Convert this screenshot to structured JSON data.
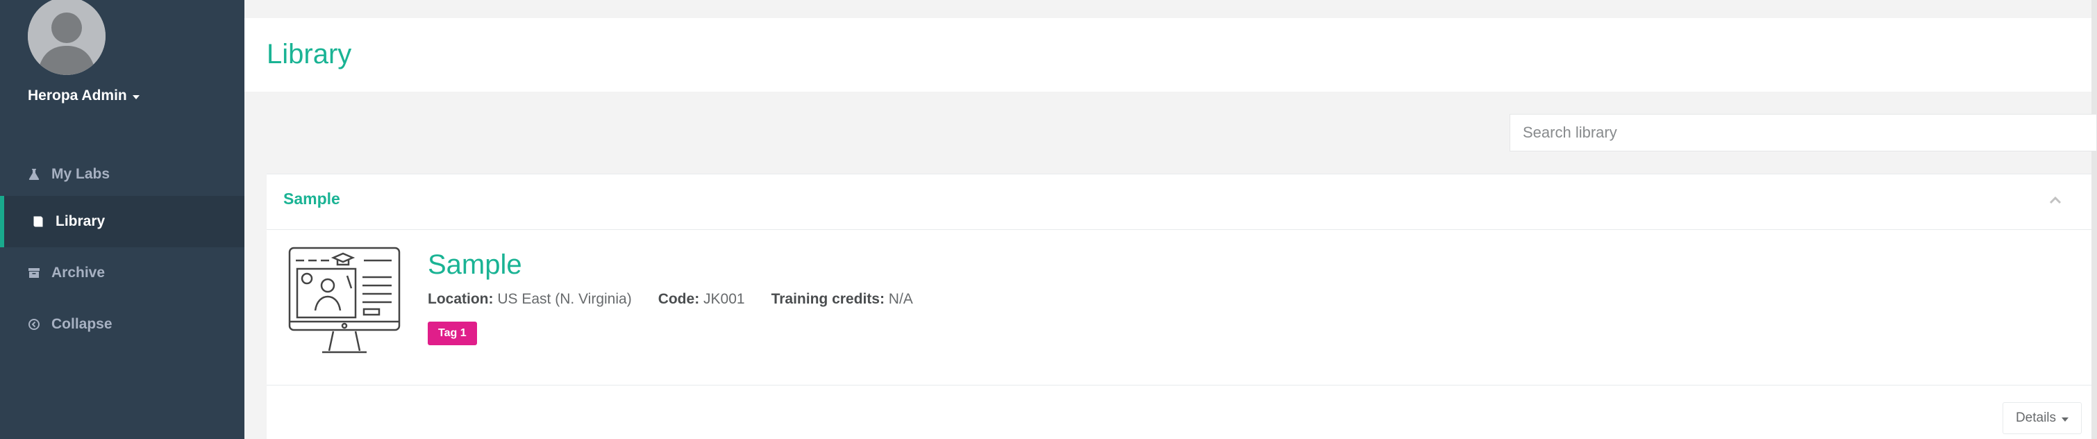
{
  "user": {
    "name": "Heropa Admin"
  },
  "sidebar": {
    "items": [
      {
        "label": "My Labs",
        "icon": "flask-icon",
        "active": false
      },
      {
        "label": "Library",
        "icon": "book-icon",
        "active": true
      },
      {
        "label": "Archive",
        "icon": "archive-icon",
        "active": false
      },
      {
        "label": "Collapse",
        "icon": "collapse-circle-icon",
        "active": false
      }
    ]
  },
  "page": {
    "title": "Library"
  },
  "search": {
    "placeholder": "Search library",
    "value": ""
  },
  "panel": {
    "title": "Sample",
    "item": {
      "title": "Sample",
      "location_label": "Location:",
      "location_value": "US East (N. Virginia)",
      "code_label": "Code:",
      "code_value": "JK001",
      "credits_label": "Training credits:",
      "credits_value": "N/A",
      "tag": "Tag 1"
    },
    "details_label": "Details"
  },
  "colors": {
    "accent": "#1ab394",
    "sidebar_bg": "#2f4050",
    "tag_bg": "#e01e8a"
  }
}
